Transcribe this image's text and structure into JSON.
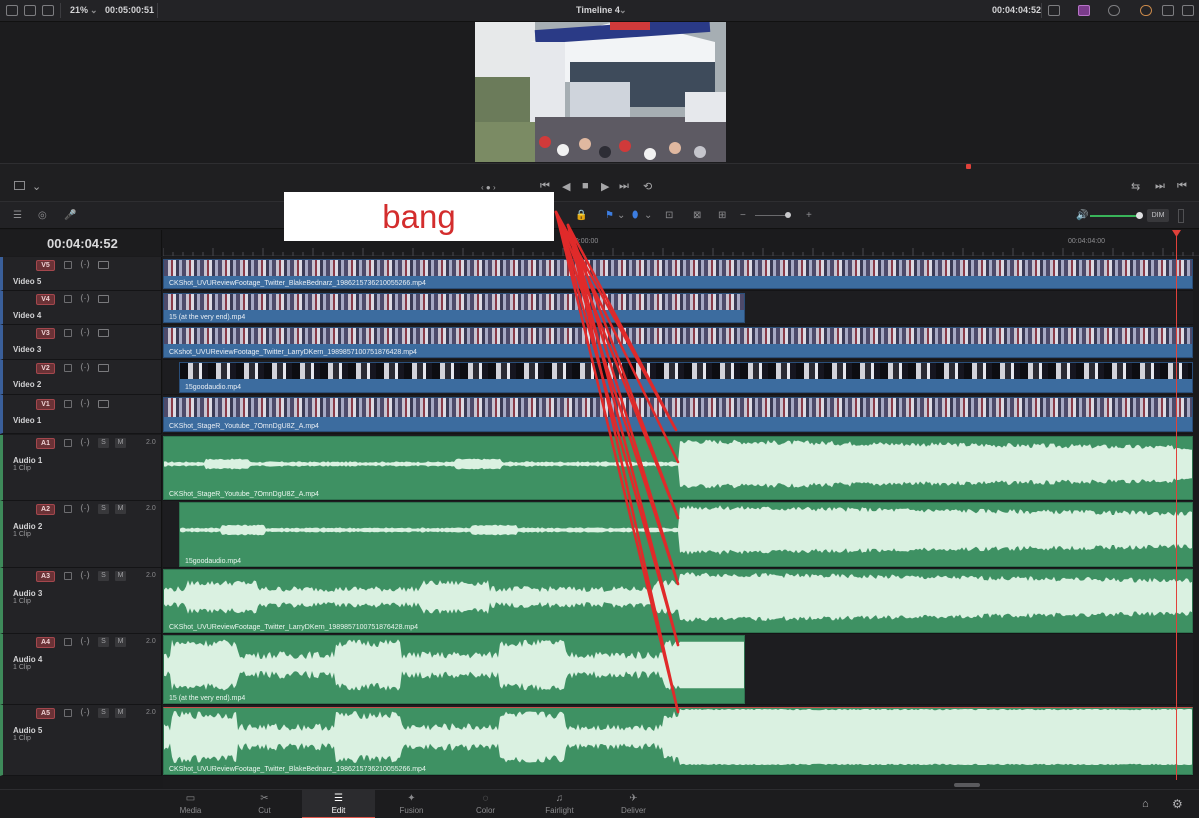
{
  "topbar": {
    "zoom": "21%",
    "source_timecode": "00:05:00:51",
    "timeline_title": "Timeline 4",
    "record_timecode": "00:04:04:52"
  },
  "timeline": {
    "current_timecode": "00:04:04:52",
    "ruler_labels": [
      "00:00:00",
      "00:04:04:00"
    ],
    "dim_label": "DIM"
  },
  "tracks": {
    "video": [
      {
        "id": "V5",
        "name": "Video 5",
        "clip": "CKShot_UVUReviewFootage_Twitter_BlakeBednarz_1986215736210055266.mp4"
      },
      {
        "id": "V4",
        "name": "Video 4",
        "clip": "15 (at the very end).mp4"
      },
      {
        "id": "V3",
        "name": "Video 3",
        "clip": "CKshot_UVUReviewFootage_Twitter_LarryDKern_1989857100751876428.mp4"
      },
      {
        "id": "V2",
        "name": "Video 2",
        "clip": "15goodaudio.mp4"
      },
      {
        "id": "V1",
        "name": "Video 1",
        "clip": "CKShot_StageR_Youtube_7OmnDgU8Z_A.mp4"
      }
    ],
    "audio": [
      {
        "id": "A1",
        "name": "Audio 1",
        "sub": "1 Clip",
        "vol": "2.0",
        "clip": "CKShot_StageR_Youtube_7OmnDgU8Z_A.mp4"
      },
      {
        "id": "A2",
        "name": "Audio 2",
        "sub": "1 Clip",
        "vol": "2.0",
        "clip": "15goodaudio.mp4"
      },
      {
        "id": "A3",
        "name": "Audio 3",
        "sub": "1 Clip",
        "vol": "2.0",
        "clip": "CKShot_UVUReviewFootage_Twitter_LarryDKern_1989857100751876428.mp4"
      },
      {
        "id": "A4",
        "name": "Audio 4",
        "sub": "1 Clip",
        "vol": "2.0",
        "clip": "15 (at the very end).mp4"
      },
      {
        "id": "A5",
        "name": "Audio 5",
        "sub": "1 Clip",
        "vol": "2.0",
        "clip": "CKShot_UVUReviewFootage_Twitter_BlakeBednarz_1986215736210055266.mp4"
      }
    ],
    "solo_label": "S",
    "mute_label": "M"
  },
  "pages": [
    "Media",
    "Cut",
    "Edit",
    "Fusion",
    "Color",
    "Fairlight",
    "Deliver"
  ],
  "active_page": "Edit",
  "annotation": {
    "text": "bang",
    "color": "#d32d2d"
  },
  "colors": {
    "video_clip": "#3c6c9f",
    "audio_clip": "#3e9163",
    "playhead": "#e0413a"
  }
}
